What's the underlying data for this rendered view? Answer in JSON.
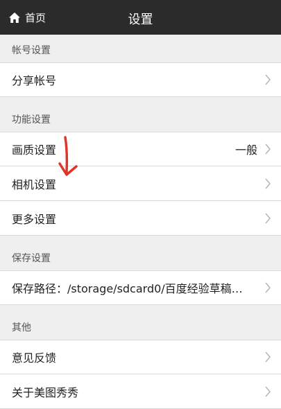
{
  "header": {
    "home_label": "首页",
    "title": "设置",
    "home_icon": "home-icon"
  },
  "sections": [
    {
      "title": "帐号设置",
      "rows": [
        {
          "label": "分享帐号",
          "value": ""
        }
      ]
    },
    {
      "title": "功能设置",
      "rows": [
        {
          "label": "画质设置",
          "value": "一般"
        },
        {
          "label": "相机设置",
          "value": ""
        },
        {
          "label": "更多设置",
          "value": ""
        }
      ]
    },
    {
      "title": "保存设置",
      "rows": [
        {
          "label": "保存路径：/storage/sdcard0/百度经验草稿…",
          "value": ""
        }
      ]
    },
    {
      "title": "其他",
      "rows": [
        {
          "label": "意见反馈",
          "value": ""
        },
        {
          "label": "关于美图秀秀",
          "value": ""
        }
      ]
    }
  ],
  "colors": {
    "topbar": "#2b2b2b",
    "background": "#efefef",
    "annotation_arrow": "#e0352b"
  }
}
